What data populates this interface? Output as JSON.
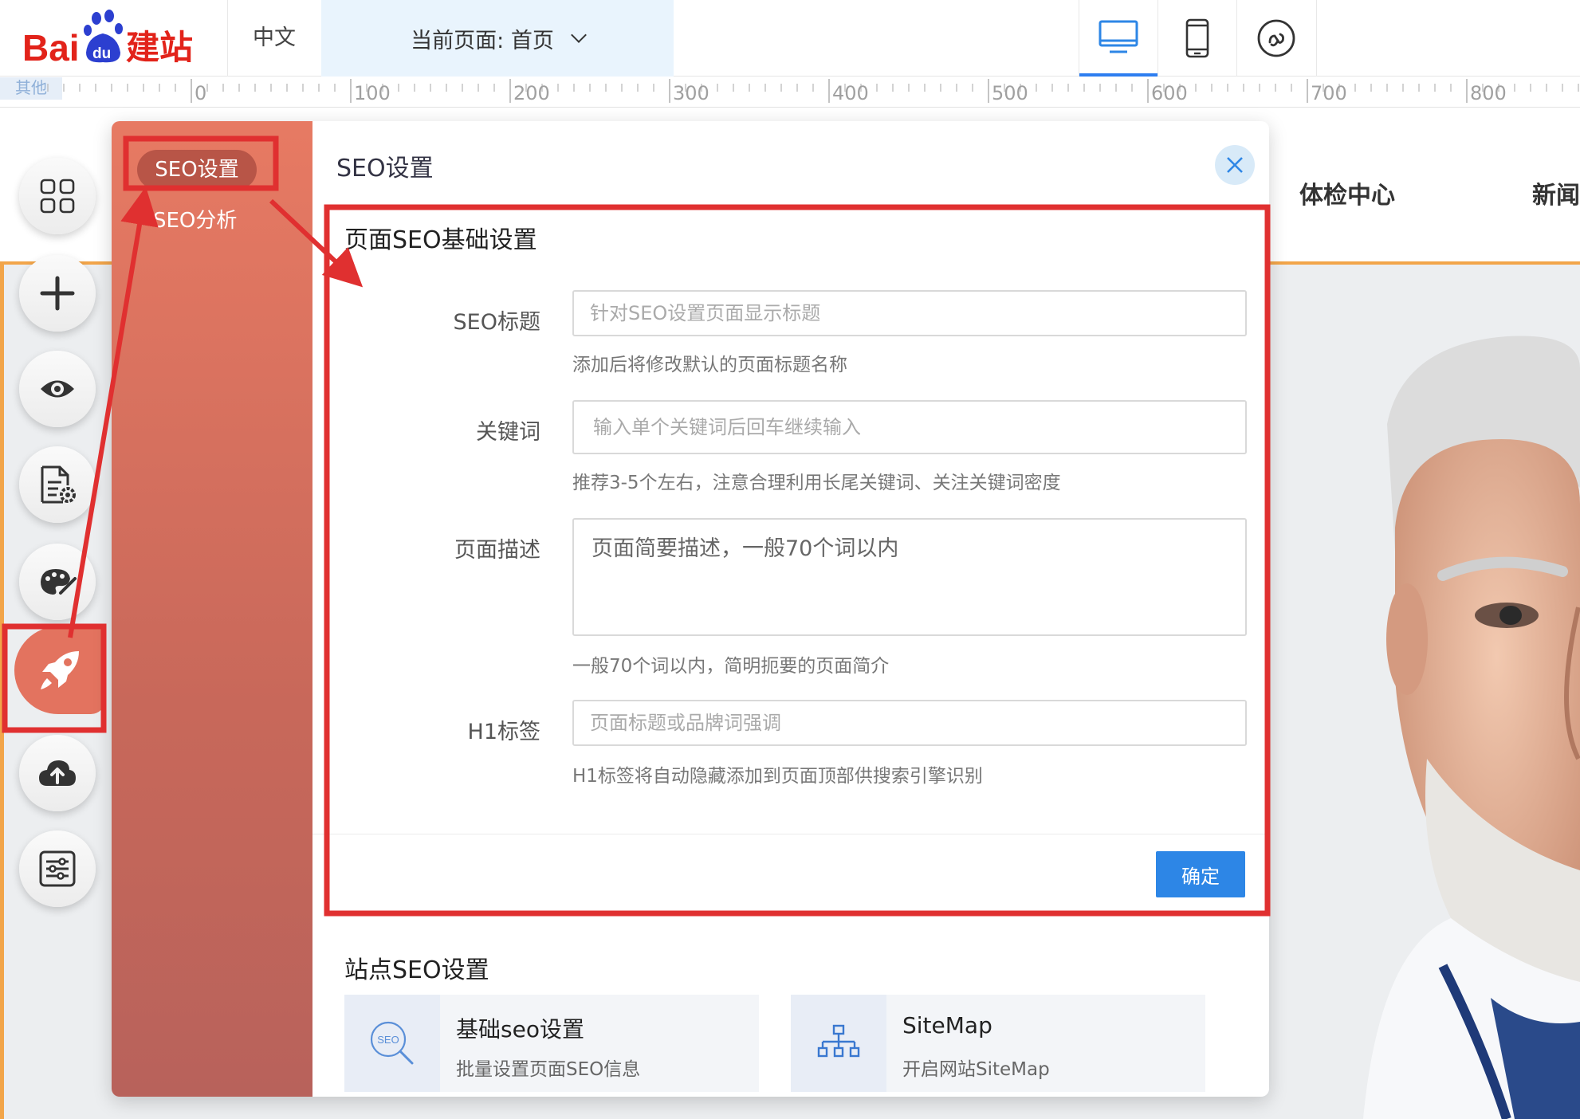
{
  "brand": {
    "logo_text_latin": "Bai",
    "logo_text_du": "du",
    "logo_text_cn": "建站"
  },
  "topbar": {
    "language": "中文",
    "current_page_label": "当前页面: 首页",
    "devices": [
      "desktop-icon",
      "mobile-icon",
      "mini-program-icon"
    ],
    "active_device": "desktop"
  },
  "ruler": {
    "corner_label": "其他",
    "labels": [
      "0",
      "100",
      "200",
      "300",
      "400",
      "500",
      "600",
      "700",
      "800"
    ]
  },
  "site_nav": {
    "items": [
      "体检中心",
      "新闻"
    ]
  },
  "rail": {
    "buttons": [
      "apps-grid-icon",
      "add-icon",
      "preview-eye-icon",
      "page-settings-icon",
      "theme-palette-icon",
      "seo-rocket-icon",
      "publish-cloud-icon",
      "settings-sliders-icon"
    ],
    "active": "seo-rocket-icon"
  },
  "panel": {
    "side_tabs": [
      "SEO设置",
      "SEO分析"
    ],
    "active_tab": "SEO设置",
    "title": "SEO设置",
    "basic_section_title": "页面SEO基础设置",
    "fields": {
      "seo_title": {
        "label": "SEO标题",
        "placeholder": "针对SEO设置页面显示标题",
        "hint": "添加后将修改默认的页面标题名称"
      },
      "keywords": {
        "label": "关键词",
        "placeholder": "输入单个关键词后回车继续输入",
        "hint": "推荐3-5个左右，注意合理利用长尾关键词、关注关键词密度"
      },
      "description": {
        "label": "页面描述",
        "placeholder": "页面简要描述，一般70个词以内",
        "hint": "一般70个词以内，简明扼要的页面简介"
      },
      "h1": {
        "label": "H1标签",
        "placeholder": "页面标题或品牌词强调",
        "hint": "H1标签将自动隐藏添加到页面顶部供搜索引擎识别"
      }
    },
    "confirm_label": "确定",
    "site_section_title": "站点SEO设置",
    "cards": [
      {
        "icon": "seo-search-icon",
        "icon_text": "SEO",
        "title": "基础seo设置",
        "subtitle": "批量设置页面SEO信息"
      },
      {
        "icon": "sitemap-icon",
        "title": "SiteMap",
        "subtitle": "开启网站SiteMap"
      }
    ]
  },
  "colors": {
    "accent": "#2d86e6",
    "panel_side": "#e77a63",
    "annotation": "#e03030",
    "hero_border": "#f2a54a"
  }
}
